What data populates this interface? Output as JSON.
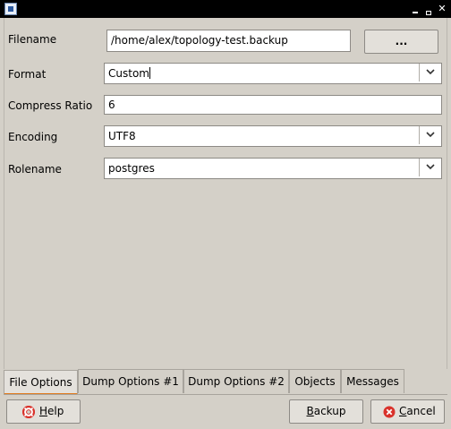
{
  "window": {
    "icon": "app-icon",
    "controls": [
      "minimize-icon",
      "maximize-icon",
      "close-icon"
    ]
  },
  "form": {
    "filename": {
      "label": "Filename",
      "value": "/home/alex/topology-test.backup",
      "browse_label": "..."
    },
    "format": {
      "label": "Format",
      "value": "Custom"
    },
    "compress_ratio": {
      "label": "Compress Ratio",
      "value": "6"
    },
    "encoding": {
      "label": "Encoding",
      "value": "UTF8"
    },
    "rolename": {
      "label": "Rolename",
      "value": "postgres"
    }
  },
  "tabs": [
    {
      "label": "File Options",
      "active": true
    },
    {
      "label": "Dump Options #1",
      "active": false
    },
    {
      "label": "Dump Options #2",
      "active": false
    },
    {
      "label": "Objects",
      "active": false
    },
    {
      "label": "Messages",
      "active": false
    }
  ],
  "buttons": {
    "help": {
      "label_first": "H",
      "label_rest": "elp"
    },
    "backup": {
      "label_first": "B",
      "label_rest": "ackup"
    },
    "cancel": {
      "label_first": "C",
      "label_rest": "ancel"
    }
  },
  "colors": {
    "window_bg": "#d4d0c8",
    "titlebar": "#000000",
    "active_tab_accent": "#e07b1e",
    "cancel_icon": "#d9322b",
    "help_icon": "#d9322b"
  }
}
